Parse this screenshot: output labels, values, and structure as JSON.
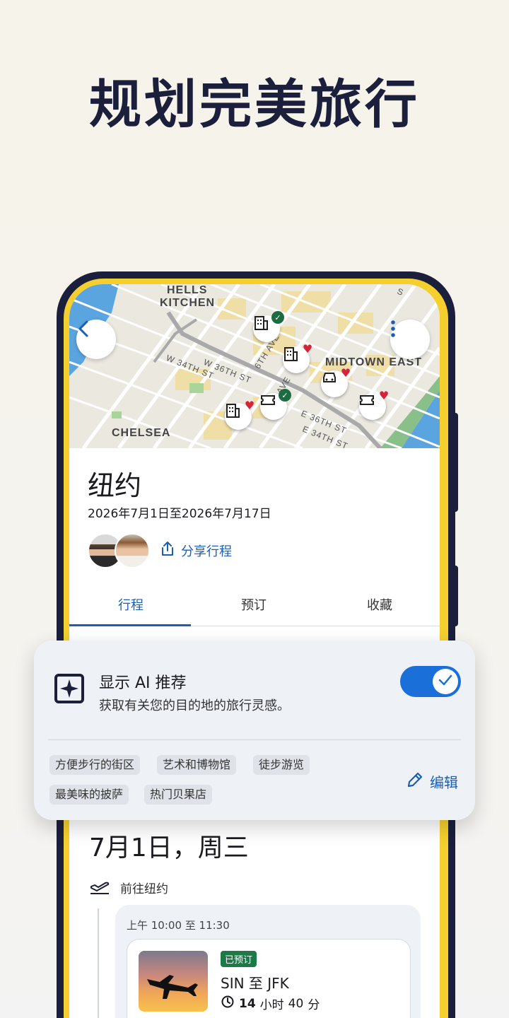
{
  "hero": {
    "title": "规划完美旅行"
  },
  "map": {
    "labels": [
      "HELLS",
      "KITCHEN",
      "MIDTOWN EAST",
      "CHELSEA"
    ],
    "streets": [
      "W 34TH ST",
      "W 36TH ST",
      "6TH AVE",
      "E 36TH ST",
      "E 34TH ST",
      "AVE",
      "S"
    ]
  },
  "trip": {
    "title": "纽约",
    "dates": "2026年7月1日至2026年7月17日",
    "share_label": "分享行程"
  },
  "tabs": [
    "行程",
    "预订",
    "收藏"
  ],
  "ai": {
    "title": "显示 AI 推荐",
    "subtitle": "获取有关您的目的地的旅行灵感。",
    "toggle_on": true,
    "chips": [
      "方便步行的街区",
      "艺术和博物馆",
      "徒步游览",
      "最美味的披萨",
      "热门贝果店"
    ],
    "edit_label": "编辑"
  },
  "day": {
    "title": "7月1日，周三",
    "leg_label": "前往纽约",
    "time": "上午 10:00 至 11:30",
    "status": "已预订",
    "route": "SIN 至 JFK",
    "duration_hours": "14",
    "duration_h_unit": "小时",
    "duration_minutes": "40",
    "duration_m_unit": "分"
  },
  "colors": {
    "accent": "#1a5fb4",
    "toggle": "#1a6fd8",
    "navy": "#1b1f3b",
    "yellow": "#f4cf2d",
    "booked": "#1b7a45",
    "heart": "#d5243a"
  }
}
